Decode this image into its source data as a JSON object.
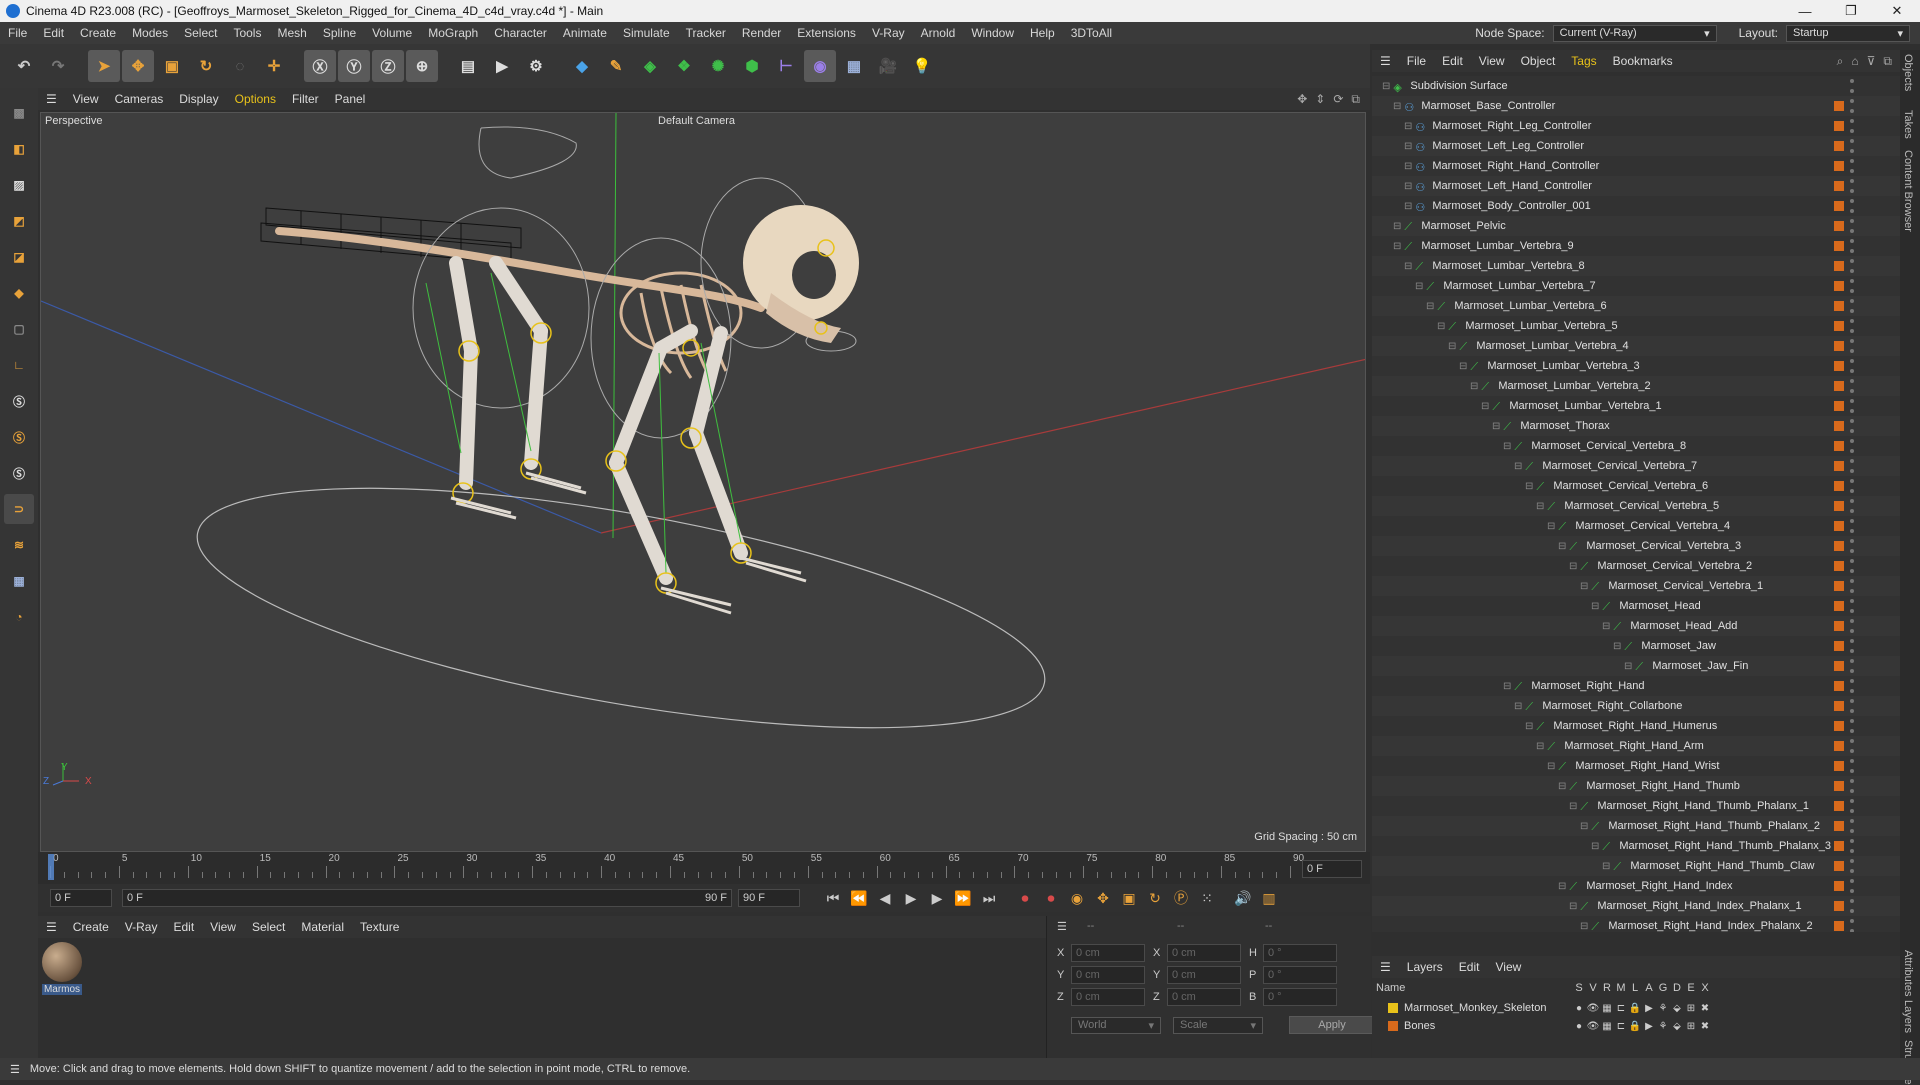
{
  "window": {
    "title": "Cinema 4D R23.008 (RC) - [Geoffroys_Marmoset_Skeleton_Rigged_for_Cinema_4D_c4d_vray.c4d *] - Main",
    "controls": [
      "—",
      "❐",
      "✕"
    ]
  },
  "menubar": {
    "items": [
      "File",
      "Edit",
      "Create",
      "Modes",
      "Select",
      "Tools",
      "Mesh",
      "Spline",
      "Volume",
      "MoGraph",
      "Character",
      "Animate",
      "Simulate",
      "Tracker",
      "Render",
      "Extensions",
      "V-Ray",
      "Arnold",
      "Window",
      "Help",
      "3DToAll"
    ],
    "node_space_label": "Node Space:",
    "node_space_value": "Current (V-Ray)",
    "layout_label": "Layout:",
    "layout_value": "Startup"
  },
  "viewport": {
    "menu": [
      "View",
      "Cameras",
      "Display",
      "Options",
      "Filter",
      "Panel"
    ],
    "view_name": "Perspective",
    "camera": "Default Camera",
    "grid_spacing": "Grid Spacing : 50 cm",
    "axis_labels": {
      "x": "X",
      "y": "Y",
      "z": "Z"
    }
  },
  "timeline": {
    "ticks": [
      "0",
      "5",
      "10",
      "15",
      "20",
      "25",
      "30",
      "35",
      "40",
      "45",
      "50",
      "55",
      "60",
      "65",
      "70",
      "75",
      "80",
      "85",
      "90"
    ],
    "current_frame": "0 F",
    "start_field": "0 F",
    "range_start": "0 F",
    "range_end": "90 F",
    "end_field": "90 F"
  },
  "material_manager": {
    "menu": [
      "Create",
      "V-Ray",
      "Edit",
      "View",
      "Select",
      "Material",
      "Texture"
    ],
    "material_name": "Marmos"
  },
  "coordinates": {
    "rows": [
      {
        "a": "X",
        "av": "0 cm",
        "b": "X",
        "bv": "0 cm",
        "c": "H",
        "cv": "0 °"
      },
      {
        "a": "Y",
        "av": "0 cm",
        "b": "Y",
        "bv": "0 cm",
        "c": "P",
        "cv": "0 °"
      },
      {
        "a": "Z",
        "av": "0 cm",
        "b": "Z",
        "bv": "0 cm",
        "c": "B",
        "cv": "0 °"
      }
    ],
    "header_left": "--",
    "header_mid": "--",
    "header_right": "--",
    "world": "World",
    "scale": "Scale",
    "apply": "Apply"
  },
  "object_manager": {
    "menu": [
      "File",
      "Edit",
      "View",
      "Object",
      "Tags",
      "Bookmarks"
    ],
    "rows": [
      {
        "name": "Subdivision Surface",
        "depth": 0,
        "kind": "subd"
      },
      {
        "name": "Marmoset_Base_Controller",
        "depth": 1,
        "kind": "ctrl"
      },
      {
        "name": "Marmoset_Right_Leg_Controller",
        "depth": 2,
        "kind": "ctrl"
      },
      {
        "name": "Marmoset_Left_Leg_Controller",
        "depth": 2,
        "kind": "ctrl"
      },
      {
        "name": "Marmoset_Right_Hand_Controller",
        "depth": 2,
        "kind": "ctrl"
      },
      {
        "name": "Marmoset_Left_Hand_Controller",
        "depth": 2,
        "kind": "ctrl"
      },
      {
        "name": "Marmoset_Body_Controller_001",
        "depth": 2,
        "kind": "ctrl"
      },
      {
        "name": "Marmoset_Pelvic",
        "depth": 1,
        "kind": "bone"
      },
      {
        "name": "Marmoset_Lumbar_Vertebra_9",
        "depth": 1,
        "kind": "bone"
      },
      {
        "name": "Marmoset_Lumbar_Vertebra_8",
        "depth": 2,
        "kind": "bone"
      },
      {
        "name": "Marmoset_Lumbar_Vertebra_7",
        "depth": 3,
        "kind": "bone"
      },
      {
        "name": "Marmoset_Lumbar_Vertebra_6",
        "depth": 4,
        "kind": "bone"
      },
      {
        "name": "Marmoset_Lumbar_Vertebra_5",
        "depth": 5,
        "kind": "bone"
      },
      {
        "name": "Marmoset_Lumbar_Vertebra_4",
        "depth": 6,
        "kind": "bone"
      },
      {
        "name": "Marmoset_Lumbar_Vertebra_3",
        "depth": 7,
        "kind": "bone"
      },
      {
        "name": "Marmoset_Lumbar_Vertebra_2",
        "depth": 8,
        "kind": "bone"
      },
      {
        "name": "Marmoset_Lumbar_Vertebra_1",
        "depth": 9,
        "kind": "bone"
      },
      {
        "name": "Marmoset_Thorax",
        "depth": 10,
        "kind": "bone"
      },
      {
        "name": "Marmoset_Cervical_Vertebra_8",
        "depth": 11,
        "kind": "bone"
      },
      {
        "name": "Marmoset_Cervical_Vertebra_7",
        "depth": 12,
        "kind": "bone"
      },
      {
        "name": "Marmoset_Cervical_Vertebra_6",
        "depth": 13,
        "kind": "bone"
      },
      {
        "name": "Marmoset_Cervical_Vertebra_5",
        "depth": 14,
        "kind": "bone"
      },
      {
        "name": "Marmoset_Cervical_Vertebra_4",
        "depth": 15,
        "kind": "bone"
      },
      {
        "name": "Marmoset_Cervical_Vertebra_3",
        "depth": 16,
        "kind": "bone"
      },
      {
        "name": "Marmoset_Cervical_Vertebra_2",
        "depth": 17,
        "kind": "bone"
      },
      {
        "name": "Marmoset_Cervical_Vertebra_1",
        "depth": 18,
        "kind": "bone"
      },
      {
        "name": "Marmoset_Head",
        "depth": 19,
        "kind": "bone"
      },
      {
        "name": "Marmoset_Head_Add",
        "depth": 20,
        "kind": "bone"
      },
      {
        "name": "Marmoset_Jaw",
        "depth": 21,
        "kind": "bone"
      },
      {
        "name": "Marmoset_Jaw_Fin",
        "depth": 22,
        "kind": "bone"
      },
      {
        "name": "Marmoset_Right_Hand",
        "depth": 11,
        "kind": "bone"
      },
      {
        "name": "Marmoset_Right_Collarbone",
        "depth": 12,
        "kind": "bone"
      },
      {
        "name": "Marmoset_Right_Hand_Humerus",
        "depth": 13,
        "kind": "bone"
      },
      {
        "name": "Marmoset_Right_Hand_Arm",
        "depth": 14,
        "kind": "bone"
      },
      {
        "name": "Marmoset_Right_Hand_Wrist",
        "depth": 15,
        "kind": "bone"
      },
      {
        "name": "Marmoset_Right_Hand_Thumb",
        "depth": 16,
        "kind": "bone"
      },
      {
        "name": "Marmoset_Right_Hand_Thumb_Phalanx_1",
        "depth": 17,
        "kind": "bone"
      },
      {
        "name": "Marmoset_Right_Hand_Thumb_Phalanx_2",
        "depth": 18,
        "kind": "bone"
      },
      {
        "name": "Marmoset_Right_Hand_Thumb_Phalanx_3",
        "depth": 19,
        "kind": "bone"
      },
      {
        "name": "Marmoset_Right_Hand_Thumb_Claw",
        "depth": 20,
        "kind": "bone"
      },
      {
        "name": "Marmoset_Right_Hand_Index",
        "depth": 16,
        "kind": "bone"
      },
      {
        "name": "Marmoset_Right_Hand_Index_Phalanx_1",
        "depth": 17,
        "kind": "bone"
      },
      {
        "name": "Marmoset_Right_Hand_Index_Phalanx_2",
        "depth": 18,
        "kind": "bone"
      }
    ]
  },
  "side_tabs": [
    "Objects",
    "Takes",
    "Content Browser",
    "Attributes",
    "Layers",
    "Structure"
  ],
  "layers": {
    "menu": [
      "Layers",
      "Edit",
      "View"
    ],
    "name_header": "Name",
    "flag_headers": [
      "S",
      "V",
      "R",
      "M",
      "L",
      "A",
      "G",
      "D",
      "E",
      "X"
    ],
    "items": [
      {
        "name": "Marmoset_Monkey_Skeleton",
        "color": "#e8c21a"
      },
      {
        "name": "Bones",
        "color": "#d86a1c"
      }
    ]
  },
  "status": "Move: Click and drag to move elements. Hold down SHIFT to quantize movement / add to the selection in point mode, CTRL to remove.",
  "colors": {
    "tag_orange": "#d86a1c",
    "bone_green": "#3fbf4a",
    "ctrl_blue": "#5ba3e0"
  }
}
